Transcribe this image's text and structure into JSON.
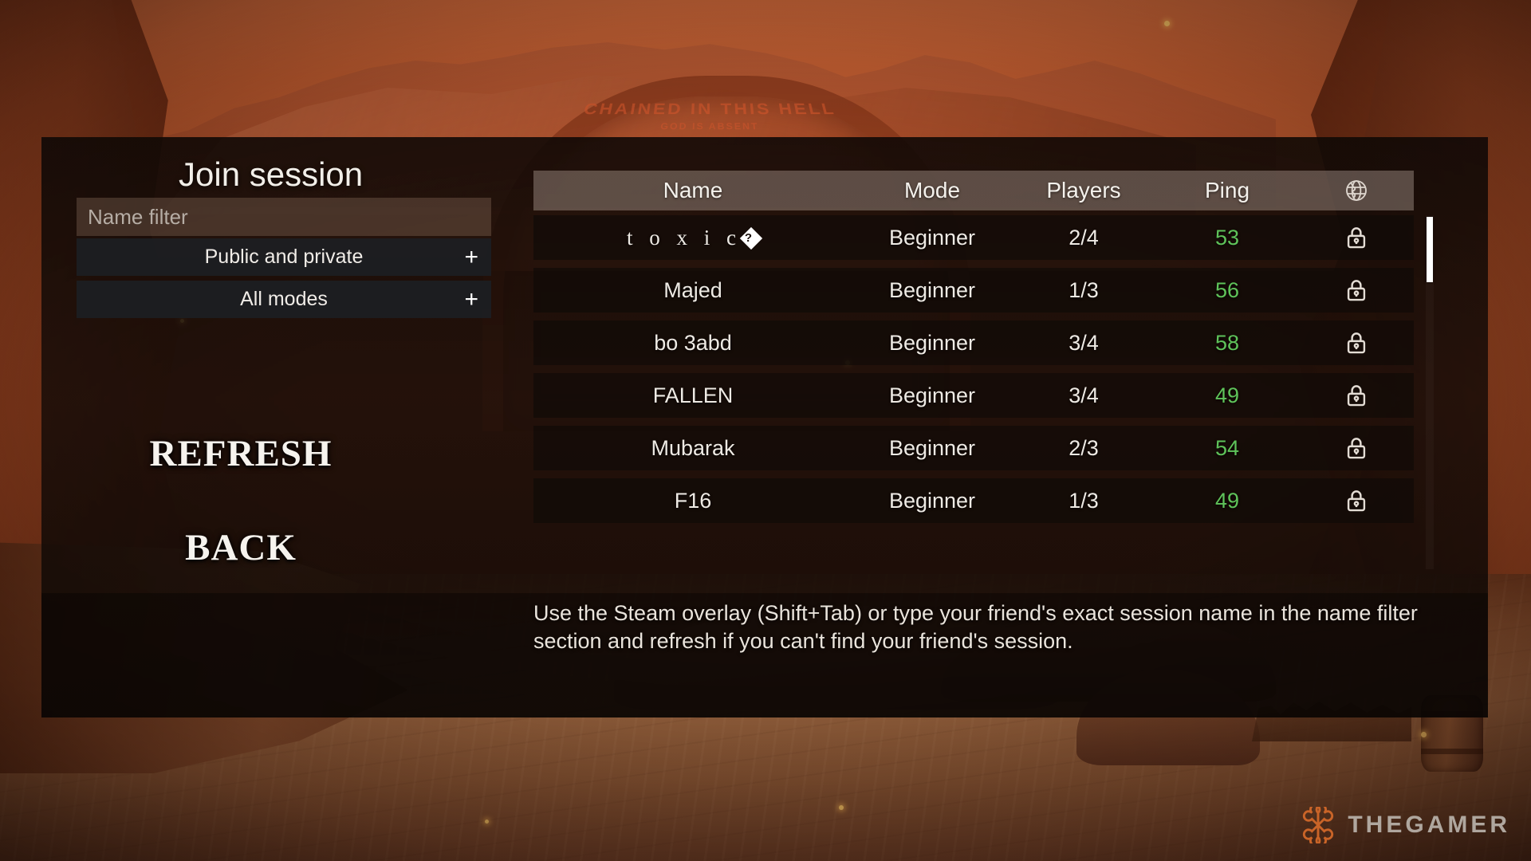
{
  "screen": {
    "game_background": "orange-desert-canyon",
    "arch_inscription": "CHAINED IN THIS HELL",
    "arch_inscription_sub": "GOD IS ABSENT"
  },
  "dialog": {
    "title": "Join session",
    "name_filter": {
      "placeholder": "Name filter",
      "value": ""
    },
    "filters": [
      {
        "label": "Public and private",
        "expander": "+"
      },
      {
        "label": "All modes",
        "expander": "+"
      }
    ],
    "buttons": [
      {
        "label": "REFRESH",
        "name": "refresh-button"
      },
      {
        "label": "BACK",
        "name": "back-button"
      }
    ],
    "hint": "Use the Steam overlay (Shift+Tab) or type your friend's exact session name in the name filter section and refresh if you can't find your friend's session."
  },
  "session_table": {
    "columns": [
      "Name",
      "Mode",
      "Players",
      "Ping"
    ],
    "lock_column_icon": "globe-icon",
    "rows": [
      {
        "name": "t o x i c",
        "name_has_replacement_char": true,
        "mode": "Beginner",
        "players": "2/4",
        "ping": "53",
        "privacy_icon": "lock-icon"
      },
      {
        "name": "Majed",
        "name_has_replacement_char": false,
        "mode": "Beginner",
        "players": "1/3",
        "ping": "56",
        "privacy_icon": "lock-icon"
      },
      {
        "name": "bo 3abd",
        "name_has_replacement_char": false,
        "mode": "Beginner",
        "players": "3/4",
        "ping": "58",
        "privacy_icon": "lock-icon"
      },
      {
        "name": "FALLEN",
        "name_has_replacement_char": false,
        "mode": "Beginner",
        "players": "3/4",
        "ping": "49",
        "privacy_icon": "lock-icon"
      },
      {
        "name": "Mubarak",
        "name_has_replacement_char": false,
        "mode": "Beginner",
        "players": "2/3",
        "ping": "54",
        "privacy_icon": "lock-icon"
      },
      {
        "name": "F16",
        "name_has_replacement_char": false,
        "mode": "Beginner",
        "players": "1/3",
        "ping": "49",
        "privacy_icon": "lock-icon"
      }
    ]
  },
  "watermark": {
    "text": "THEGAMER",
    "accent_color": "#d4692a"
  },
  "colors": {
    "ping_good": "#5fc35a",
    "panel_background": "#120a07",
    "row_background": "#1a110c",
    "header_background": "#b2a298",
    "text_primary": "#f2efe9",
    "placeholder": "#b6ada5"
  }
}
